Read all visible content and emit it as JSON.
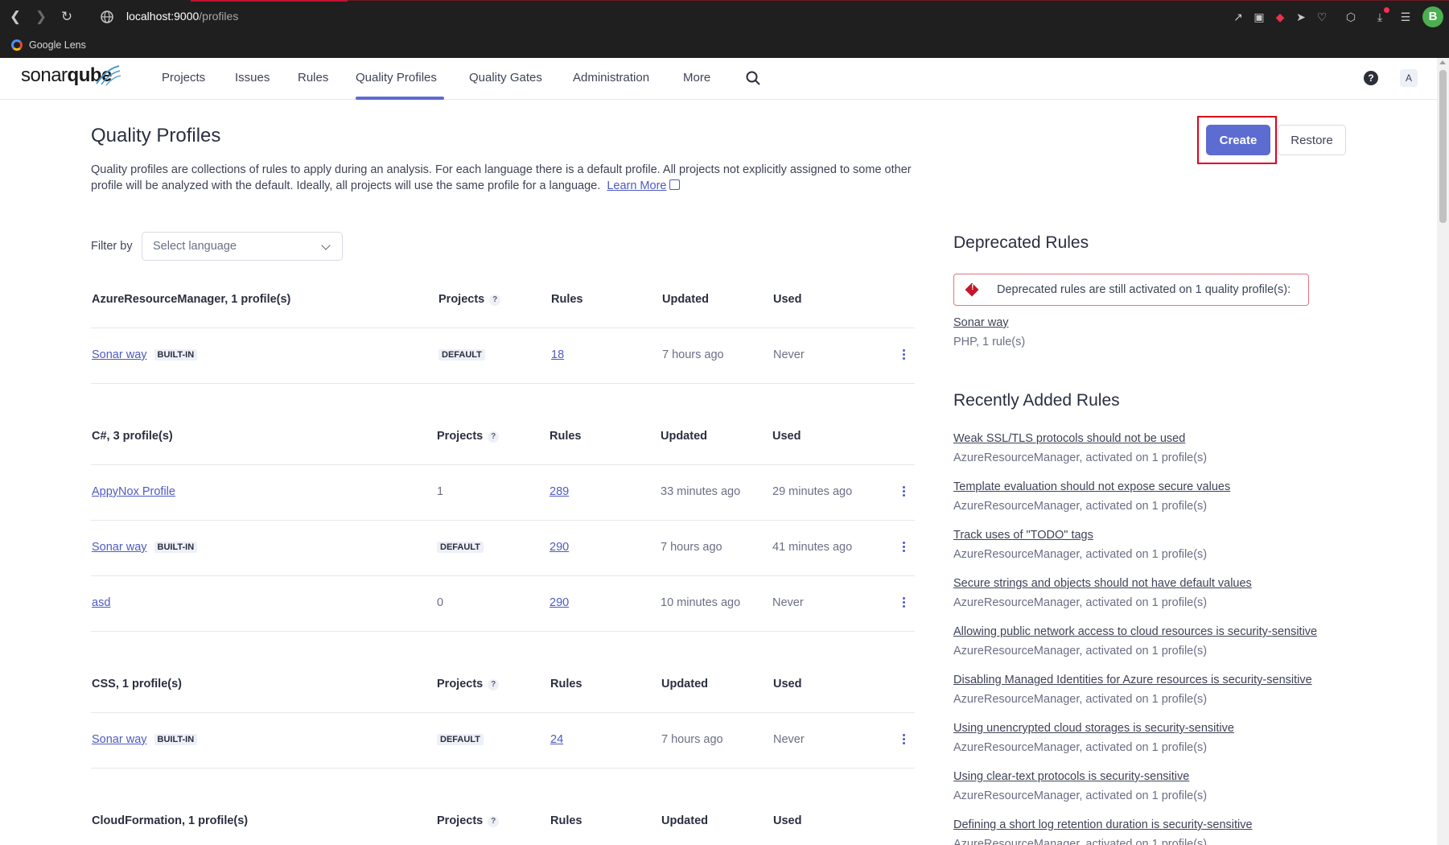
{
  "browser": {
    "url_host": "localhost:9000",
    "url_path": "/profiles",
    "bookmark": "Google Lens",
    "profile_initial": "B"
  },
  "nav": {
    "logo_text_1": "sonar",
    "logo_text_2": "qube",
    "items": [
      "Projects",
      "Issues",
      "Rules",
      "Quality Profiles",
      "Quality Gates",
      "Administration",
      "More"
    ],
    "active": "Quality Profiles",
    "help": "?",
    "user_initial": "A"
  },
  "page": {
    "title": "Quality Profiles",
    "description": "Quality profiles are collections of rules to apply during an analysis. For each language there is a default profile. All projects not explicitly assigned to some other profile will be analyzed with the default. Ideally, all projects will use the same profile for a language.",
    "learn_more": "Learn More",
    "create_label": "Create",
    "restore_label": "Restore",
    "filter_label": "Filter by",
    "filter_placeholder": "Select language"
  },
  "columns": {
    "projects": "Projects",
    "rules": "Rules",
    "updated": "Updated",
    "used": "Used",
    "help": "?"
  },
  "languages": [
    {
      "header": "AzureResourceManager, 1 profile(s)",
      "profiles": [
        {
          "name": "Sonar way",
          "builtin": "BUILT-IN",
          "projects": "DEFAULT",
          "rules": "18",
          "updated": "7 hours ago",
          "used": "Never"
        }
      ]
    },
    {
      "header": "C#, 3 profile(s)",
      "profiles": [
        {
          "name": "AppyNox Profile",
          "builtin": "",
          "projects": "1",
          "rules": "289",
          "updated": "33 minutes ago",
          "used": "29 minutes ago"
        },
        {
          "name": "Sonar way",
          "builtin": "BUILT-IN",
          "projects": "DEFAULT",
          "rules": "290",
          "updated": "7 hours ago",
          "used": "41 minutes ago"
        },
        {
          "name": "asd",
          "builtin": "",
          "projects": "0",
          "rules": "290",
          "updated": "10 minutes ago",
          "used": "Never"
        }
      ]
    },
    {
      "header": "CSS, 1 profile(s)",
      "profiles": [
        {
          "name": "Sonar way",
          "builtin": "BUILT-IN",
          "projects": "DEFAULT",
          "rules": "24",
          "updated": "7 hours ago",
          "used": "Never"
        }
      ]
    },
    {
      "header": "CloudFormation, 1 profile(s)",
      "profiles": []
    }
  ],
  "deprecated": {
    "title": "Deprecated Rules",
    "alert": "Deprecated rules are still activated on 1 quality profile(s):",
    "profile_name": "Sonar way",
    "profile_sub": "PHP, 1 rule(s)"
  },
  "recent": {
    "title": "Recently Added Rules",
    "items": [
      {
        "name": "Weak SSL/TLS protocols should not be used",
        "sub": "AzureResourceManager, activated on 1 profile(s)"
      },
      {
        "name": "Template evaluation should not expose secure values",
        "sub": "AzureResourceManager, activated on 1 profile(s)"
      },
      {
        "name": "Track uses of \"TODO\" tags",
        "sub": "AzureResourceManager, activated on 1 profile(s)"
      },
      {
        "name": "Secure strings and objects should not have default values",
        "sub": "AzureResourceManager, activated on 1 profile(s)"
      },
      {
        "name": "Allowing public network access to cloud resources is security-sensitive",
        "sub": "AzureResourceManager, activated on 1 profile(s)"
      },
      {
        "name": "Disabling Managed Identities for Azure resources is security-sensitive",
        "sub": "AzureResourceManager, activated on 1 profile(s)"
      },
      {
        "name": "Using unencrypted cloud storages is security-sensitive",
        "sub": "AzureResourceManager, activated on 1 profile(s)"
      },
      {
        "name": "Using clear-text protocols is security-sensitive",
        "sub": "AzureResourceManager, activated on 1 profile(s)"
      },
      {
        "name": "Defining a short log retention duration is security-sensitive",
        "sub": "AzureResourceManager, activated on 1 profile(s)"
      }
    ]
  }
}
